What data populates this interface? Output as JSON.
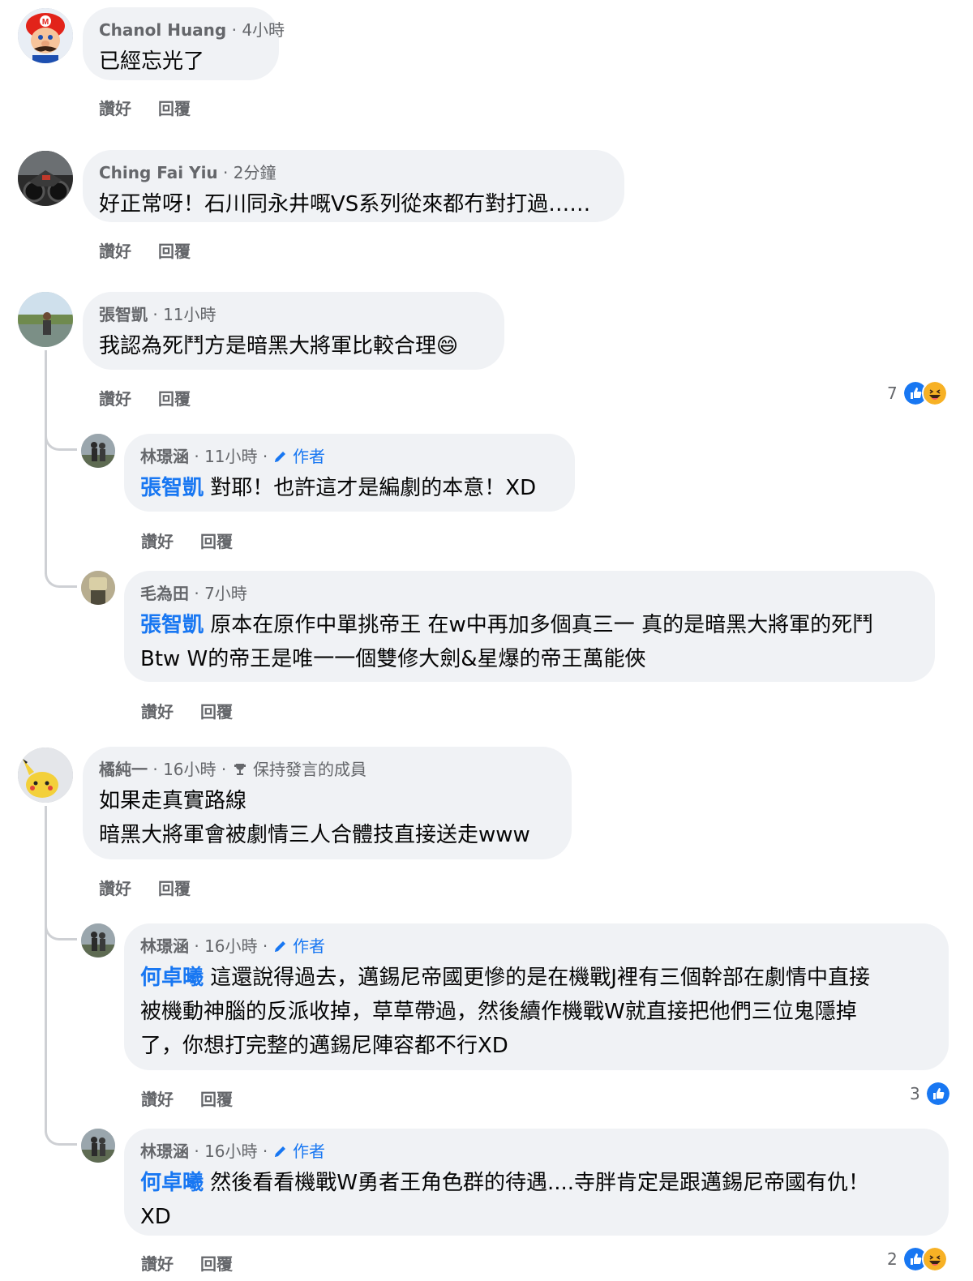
{
  "actions": {
    "like": "讚好",
    "reply": "回覆"
  },
  "comments": [
    {
      "name": "Chanol Huang",
      "time": "4小時",
      "text": "已經忘光了"
    },
    {
      "name": "Ching Fai Yiu",
      "time": "2分鐘",
      "text": "好正常呀！石川同永井嘅VS系列從來都冇對打過……"
    },
    {
      "name": "張智凱",
      "time": "11小時",
      "text": "我認為死鬥方是暗黑大將軍比較合理😄",
      "reactions": {
        "count": "7"
      },
      "replies": [
        {
          "name": "林璟涵",
          "time": "11小時",
          "author_label": "作者",
          "mention": "張智凱",
          "text": "對耶！也許這才是編劇的本意！XD"
        },
        {
          "name": "毛為田",
          "time": "7小時",
          "mention": "張智凱",
          "text": "原本在原作中單挑帝王 在w中再加多個真三一 真的是暗黑大將軍的死鬥\nBtw W的帝王是唯一一個雙修大劍&星爆的帝王萬能俠"
        }
      ]
    },
    {
      "name": "橘純一",
      "time": "16小時",
      "badge": "保持發言的成員",
      "text": "如果走真實路線\n暗黑大將軍會被劇情三人合體技直接送走www",
      "replies": [
        {
          "name": "林璟涵",
          "time": "16小時",
          "author_label": "作者",
          "mention": "何卓曦",
          "text": "這還說得過去，邁錫尼帝國更慘的是在機戰J裡有三個幹部在劇情中直接\n被機動神腦的反派收掉，草草帶過，然後續作機戰W就直接把他們三位鬼隱掉\n了，你想打完整的邁錫尼陣容都不行XD",
          "reactions": {
            "count": "3"
          }
        },
        {
          "name": "林璟涵",
          "time": "16小時",
          "author_label": "作者",
          "mention": "何卓曦",
          "text": "然後看看機戰W勇者王角色群的待遇....寺胖肯定是跟邁錫尼帝國有仇！\nXD",
          "reactions": {
            "count": "2"
          }
        }
      ]
    }
  ]
}
